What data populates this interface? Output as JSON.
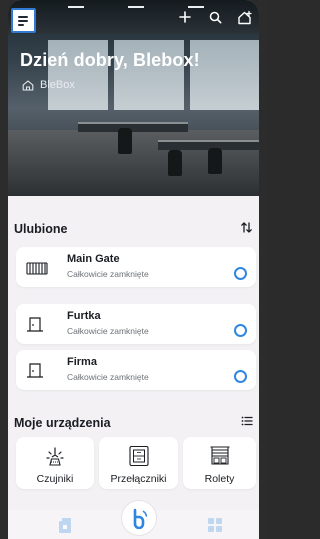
{
  "colors": {
    "accent": "#2f86e0",
    "text": "#1a1d22",
    "muted": "#6d7278",
    "background": "#f3f1f4",
    "card": "#ffffff"
  },
  "header": {
    "greeting": "Dzień dobry, Blebox!",
    "location": "BleBox",
    "icons": [
      "menu-icon",
      "plus-icon",
      "search-icon",
      "home-settings-icon"
    ]
  },
  "favorites": {
    "title": "Ulubione",
    "sort_icon": "sort-icon",
    "items": [
      {
        "name": "Main Gate",
        "state": "Całkowicie zamknięte",
        "icon": "gate-icon"
      },
      {
        "name": "Furtka",
        "state": "Całkowicie zamknięte",
        "icon": "door-icon"
      },
      {
        "name": "Firma",
        "state": "Całkowicie zamknięte",
        "icon": "door-icon"
      }
    ]
  },
  "devices": {
    "title": "Moje urządzenia",
    "list_icon": "list-icon",
    "tiles": [
      {
        "label": "Czujniki",
        "icon": "sensor-icon"
      },
      {
        "label": "Przełączniki",
        "icon": "switch-icon"
      },
      {
        "label": "Rolety",
        "icon": "blinds-icon"
      }
    ]
  },
  "bottom_nav": {
    "items": [
      "devices-nav-icon",
      "blebox-logo-icon",
      "dashboard-nav-icon"
    ]
  }
}
